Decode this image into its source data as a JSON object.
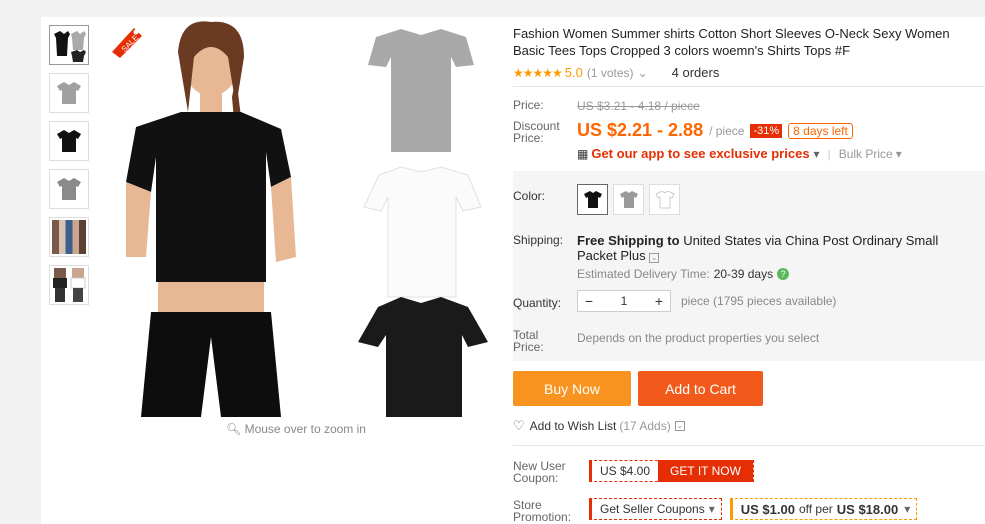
{
  "gallery": {
    "thumbnails": [
      "black-shirt-thumb",
      "gray-shirt-thumb",
      "black-shirt-front-thumb",
      "gray-shirt-front-thumb",
      "models-group-thumb",
      "models-pair-thumb"
    ],
    "zoom_hint": "Mouse over to zoom in",
    "badge": "SALE"
  },
  "product": {
    "title": "Fashion Women Summer shirts Cotton Short Sleeves O-Neck Sexy Women Basic Tees Tops Cropped 3 colors woemn's Shirts Tops #F",
    "stars": "★★★★★",
    "rating": "5.0",
    "votes": "(1 votes)",
    "orders": "4 orders"
  },
  "price": {
    "price_label": "Price:",
    "original": "US $3.21 - 4.18 / piece",
    "discount_label_1": "Discount",
    "discount_label_2": "Price:",
    "discount_price": "US $2.21 - 2.88",
    "per": "/ piece",
    "percent_off": "-31%",
    "days_left": "8 days left",
    "app_promo": "Get our app to see exclusive prices",
    "bulk_price": "Bulk Price"
  },
  "options": {
    "color_label": "Color:",
    "colors": [
      "#111111",
      "#9a9a9a",
      "#ffffff"
    ],
    "shipping_label": "Shipping:",
    "shipping_free": "Free Shipping to",
    "shipping_dest": "United States via China Post Ordinary Small Packet Plus",
    "delivery_label": "Estimated Delivery Time:",
    "delivery_days": "20-39 days",
    "quantity_label": "Quantity:",
    "minus": "−",
    "quantity": "1",
    "plus": "+",
    "pieces_available": "piece (1795 pieces available)",
    "total_label_1": "Total",
    "total_label_2": "Price:",
    "total_note": "Depends on the product properties you select"
  },
  "actions": {
    "buy_now": "Buy Now",
    "add_to_cart": "Add to Cart",
    "wishlist": "Add to Wish List",
    "wishlist_count": "(17 Adds)"
  },
  "coupons": {
    "new_user_label_1": "New User",
    "new_user_label_2": "Coupon:",
    "coupon_value": "US $4.00",
    "get_it_now": "GET IT NOW",
    "store_label_1": "Store",
    "store_label_2": "Promotion:",
    "seller_coupons": "Get Seller Coupons",
    "promo_off": "US $1.00",
    "promo_mid": "off per",
    "promo_threshold": "US $18.00"
  }
}
